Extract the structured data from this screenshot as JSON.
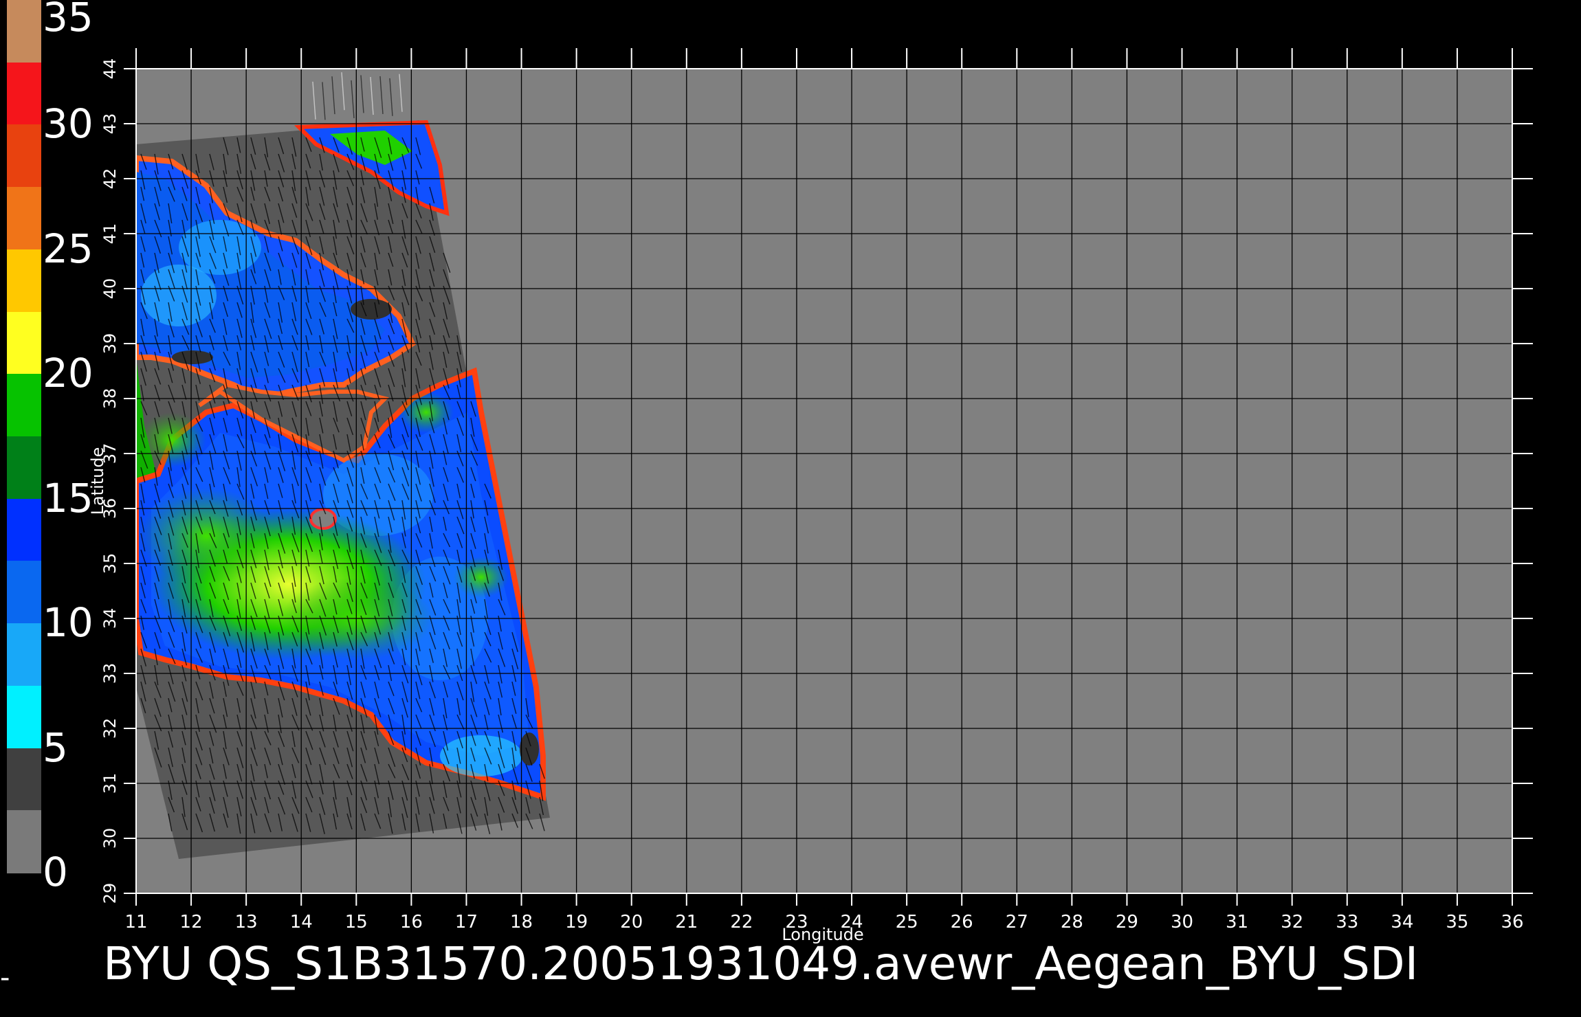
{
  "colorbar": {
    "labels": [
      "35",
      "30",
      "25",
      "20",
      "15",
      "10",
      "5",
      "0"
    ],
    "segments": [
      "#c68a5c",
      "#f5151b",
      "#e8420f",
      "#f07418",
      "#ffc800",
      "#ffff20",
      "#06c200",
      "#008018",
      "#0030ff",
      "#0a68f0",
      "#18a8f8",
      "#00f0ff",
      "#404040",
      "#7a7a7a"
    ]
  },
  "map": {
    "x_label": "Longitude",
    "y_label": "Latitude",
    "lon_ticks": [
      "11",
      "12",
      "13",
      "14",
      "15",
      "16",
      "17",
      "18",
      "19",
      "20",
      "21",
      "22",
      "23",
      "24",
      "25",
      "26",
      "27",
      "28",
      "29",
      "30",
      "31",
      "32",
      "33",
      "34",
      "35",
      "36"
    ],
    "lat_ticks": [
      "29",
      "30",
      "31",
      "32",
      "33",
      "34",
      "35",
      "36",
      "37",
      "38",
      "39",
      "40",
      "41",
      "42",
      "43",
      "44"
    ],
    "background_color": "#808080",
    "swath_color": "#585858",
    "grid_color": "#000000"
  },
  "title": "BYU  QS_S1B31570.20051931049.avewr_Aegean_BYU_SDI",
  "left_mark": "-"
}
